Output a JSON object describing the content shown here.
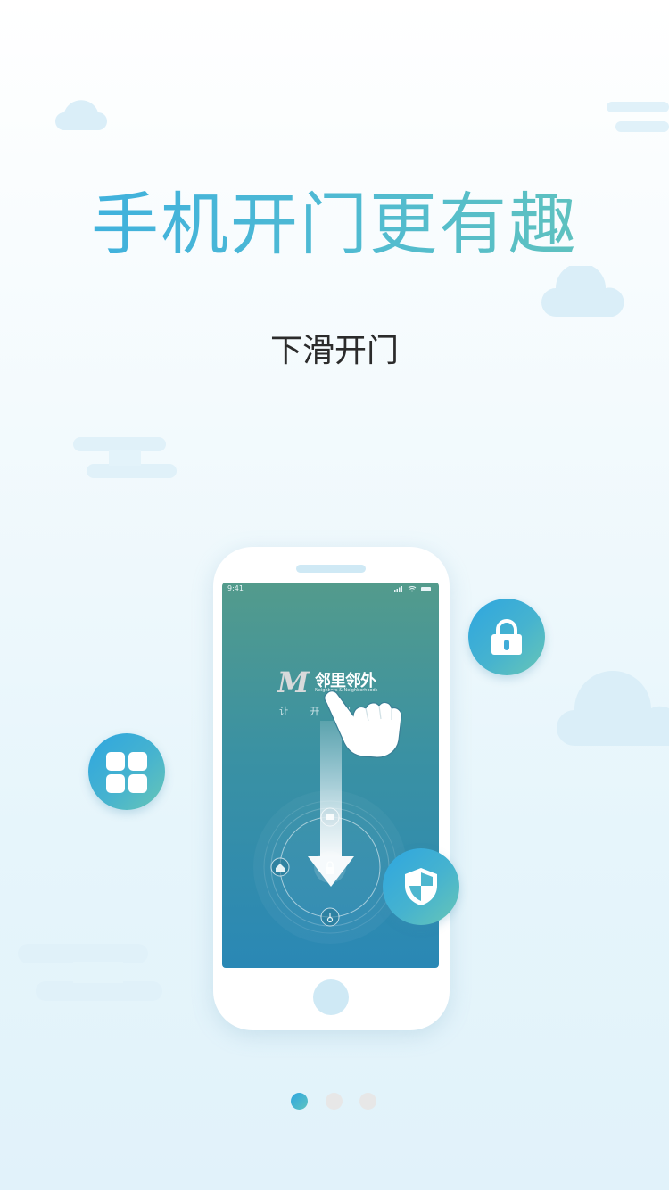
{
  "title": "手机开门更有趣",
  "subtitle": "下滑开门",
  "phone": {
    "status_time": "9:41",
    "brand_logo_letters": "M",
    "brand_name": "邻里邻外",
    "brand_tagline": "Neighbors & Neighborhoods",
    "slogan": "让 开 门"
  },
  "icons": {
    "lock": "lock-icon",
    "apps": "app-grid-icon",
    "shield": "shield-icon",
    "hand": "hand-pointer-icon",
    "arrow": "arrow-down-icon"
  },
  "pagination": {
    "count": 3,
    "active": 1
  },
  "colors": {
    "accent_blue": "#2ea6e0",
    "accent_teal": "#64c4b8",
    "screen_top": "#539b8c",
    "screen_bottom": "#2a88b5",
    "cloud": "#daeef8"
  }
}
